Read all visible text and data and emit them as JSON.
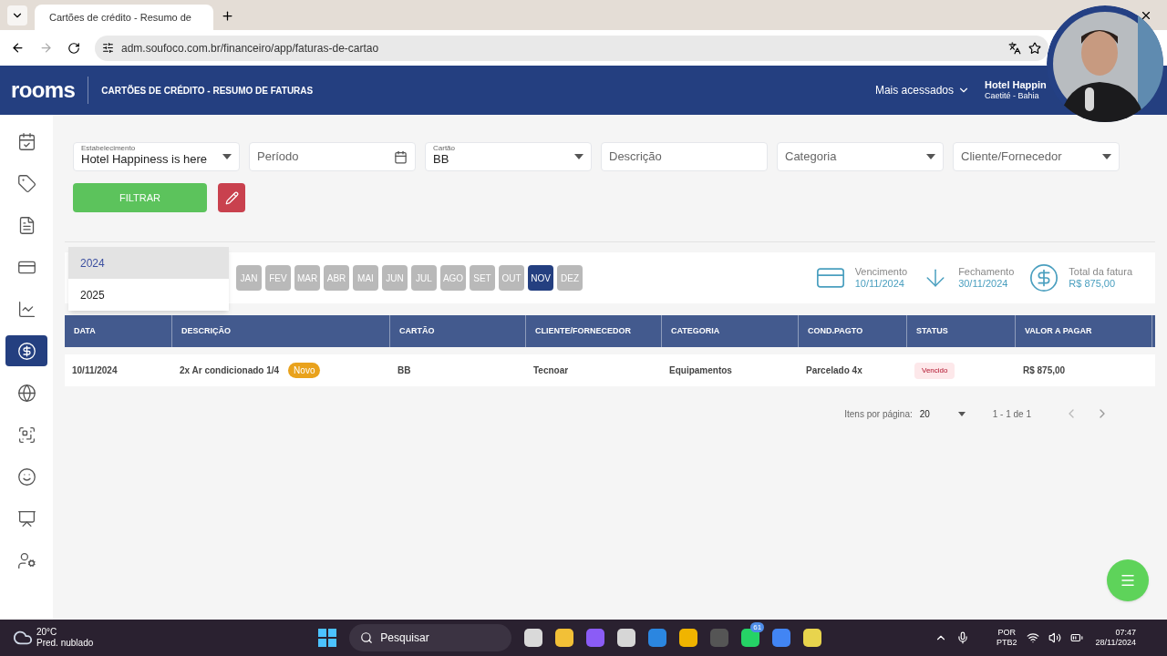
{
  "browser": {
    "tab_title": "Cartões de crédito - Resumo de",
    "url": "adm.soufoco.com.br/financeiro/app/faturas-de-cartao"
  },
  "header": {
    "logo": "rooms",
    "title": "CARTÕES DE CRÉDITO - RESUMO DE FATURAS",
    "menu": "Mais acessados",
    "hotel": "Hotel Happin",
    "location": "Caetité - Bahia"
  },
  "sidebar": {
    "items": [
      {
        "selected": false
      },
      {
        "selected": false
      },
      {
        "selected": false
      },
      {
        "selected": false
      },
      {
        "selected": false
      },
      {
        "selected": true
      },
      {
        "selected": false
      },
      {
        "selected": false
      },
      {
        "selected": false
      },
      {
        "selected": false
      },
      {
        "selected": false
      }
    ]
  },
  "filters": [
    {
      "kind": "select",
      "label": "Estabelecimento",
      "value": "Hotel Happiness is here"
    },
    {
      "kind": "date",
      "placeholder": "Período"
    },
    {
      "kind": "select",
      "label": "Cartão",
      "value": "BB"
    },
    {
      "kind": "text",
      "placeholder": "Descrição"
    },
    {
      "kind": "select",
      "placeholder": "Categoria"
    },
    {
      "kind": "select",
      "placeholder": "Cliente/Fornecedor"
    }
  ],
  "filter_button": "FILTRAR",
  "year_dropdown": {
    "options": [
      {
        "label": "2024",
        "selected": true
      },
      {
        "label": "2025",
        "selected": false
      }
    ]
  },
  "months": [
    {
      "label": "JAN",
      "selected": false
    },
    {
      "label": "FEV",
      "selected": false
    },
    {
      "label": "MAR",
      "selected": false
    },
    {
      "label": "ABR",
      "selected": false
    },
    {
      "label": "MAI",
      "selected": false
    },
    {
      "label": "JUN",
      "selected": false
    },
    {
      "label": "JUL",
      "selected": false
    },
    {
      "label": "AGO",
      "selected": false
    },
    {
      "label": "SET",
      "selected": false
    },
    {
      "label": "OUT",
      "selected": false
    },
    {
      "label": "NOV",
      "selected": true
    },
    {
      "label": "DEZ",
      "selected": false
    }
  ],
  "summary": [
    {
      "kind": "card",
      "label": "Vencimento",
      "value": "10/11/2024"
    },
    {
      "kind": "arrow",
      "label": "Fechamento",
      "value": "30/11/2024"
    },
    {
      "kind": "dollar",
      "label": "Total da fatura",
      "value": "R$ 875,00"
    }
  ],
  "table": {
    "columns": [
      "DATA",
      "DESCRIÇÃO",
      "CARTÃO",
      "CLIENTE/FORNECEDOR",
      "CATEGORIA",
      "COND.PAGTO",
      "STATUS",
      "VALOR A PAGAR"
    ],
    "rows": [
      {
        "cells": [
          "10/11/2024",
          "2x Ar condicionado 1/4",
          "BB",
          "Tecnoar",
          "Equipamentos",
          "Parcelado 4x",
          "Vencido",
          "R$ 875,00"
        ],
        "badge": "Novo"
      }
    ]
  },
  "pagination": {
    "label": "Itens por página:",
    "per_page": "20",
    "range": "1 - 1 de 1"
  },
  "taskbar": {
    "temperature": "20°C",
    "weather": "Pred. nublado",
    "search": "Pesquisar",
    "whatsapp_count": "61",
    "language": "POR",
    "layout": "PTB2",
    "time": "07:47",
    "date": "28/11/2024"
  }
}
